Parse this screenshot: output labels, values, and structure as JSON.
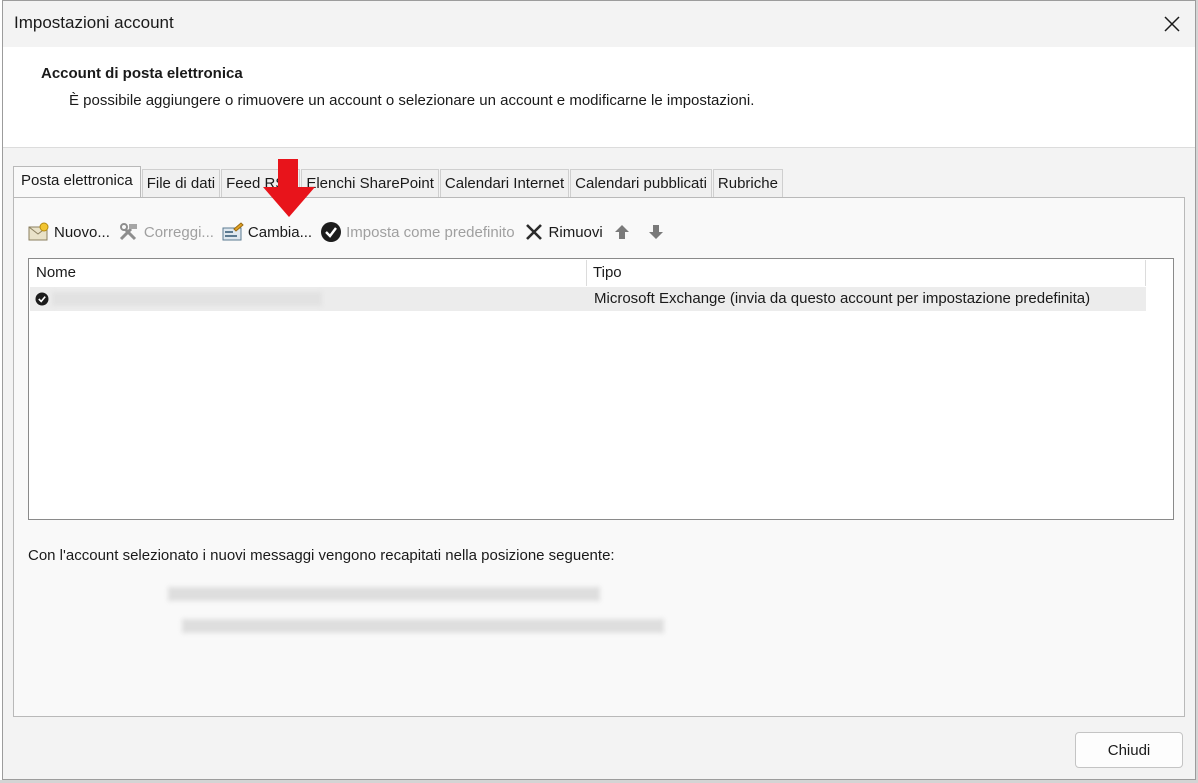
{
  "window": {
    "title": "Impostazioni account"
  },
  "header": {
    "title": "Account di posta elettronica",
    "description": "È possibile aggiungere o rimuovere un account o selezionare un account e modificarne le impostazioni."
  },
  "tabs": [
    {
      "label": "Posta elettronica",
      "active": true
    },
    {
      "label": "File di dati",
      "active": false
    },
    {
      "label": "Feed RSS",
      "active": false
    },
    {
      "label": "Elenchi SharePoint",
      "active": false
    },
    {
      "label": "Calendari Internet",
      "active": false
    },
    {
      "label": "Calendari pubblicati",
      "active": false
    },
    {
      "label": "Rubriche",
      "active": false
    }
  ],
  "toolbar": {
    "new_label": "Nuovo...",
    "repair_label": "Correggi...",
    "change_label": "Cambia...",
    "set_default_label": "Imposta come predefinito",
    "remove_label": "Rimuovi"
  },
  "list": {
    "columns": [
      "Nome",
      "Tipo"
    ],
    "rows": [
      {
        "name": "",
        "type": "Microsoft Exchange (invia da questo account per impostazione predefinita)",
        "default": true
      }
    ]
  },
  "delivery": {
    "label": "Con l'account selezionato i nuovi messaggi vengono recapitati nella posizione seguente:"
  },
  "buttons": {
    "close_label": "Chiudi"
  },
  "colors": {
    "annotation_arrow": "#e8141b",
    "dialog_background": "#f3f3f3",
    "selected_row": "#ececec"
  }
}
